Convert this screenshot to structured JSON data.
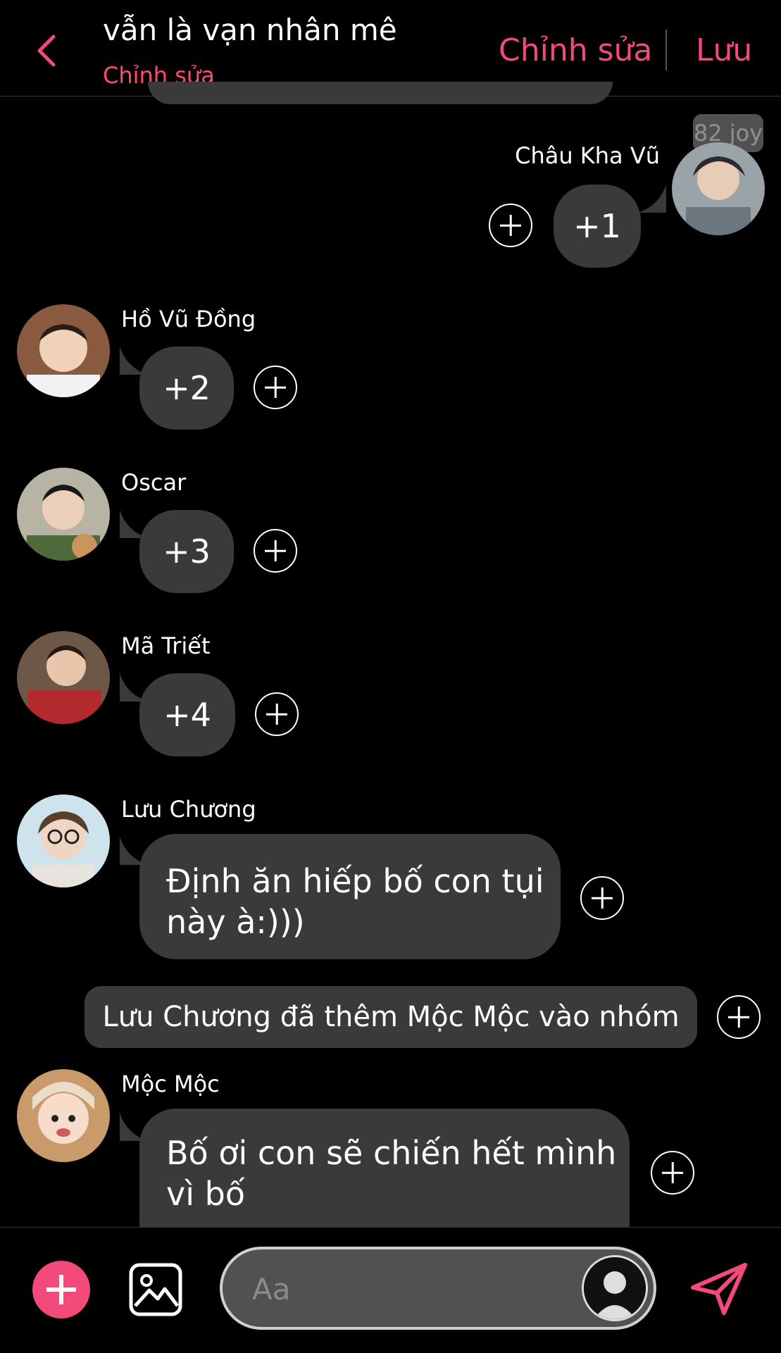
{
  "header": {
    "title": "vẫn là vạn nhân mê",
    "subtitle": "Chỉnh sửa",
    "edit_label": "Chỉnh sửa",
    "save_label": "Lưu"
  },
  "badge": "82 joy",
  "messages": [
    {
      "sender": "Châu Kha Vũ",
      "text": "+1",
      "side": "right"
    },
    {
      "sender": "Hồ Vũ Đồng",
      "text": "+2",
      "side": "left"
    },
    {
      "sender": "Oscar",
      "text": "+3",
      "side": "left"
    },
    {
      "sender": "Mã Triết",
      "text": "+4",
      "side": "left"
    },
    {
      "sender": "Lưu Chương",
      "text_lines": [
        "Định ăn hiếp bố con tụi",
        "này à:)))"
      ],
      "side": "left"
    },
    {
      "sender": "Mộc Mộc",
      "text_lines": [
        "Bố ơi con sẽ chiến hết mình",
        "vì bố"
      ],
      "side": "left"
    }
  ],
  "system_message": "Lưu Chương đã thêm Mộc Mộc vào nhóm",
  "composer": {
    "placeholder": "Aa"
  },
  "colors": {
    "accent": "#f24a7a",
    "subtitle": "#ff4c6a",
    "bubble": "#3a3a3a",
    "background": "#000000"
  },
  "icons": [
    "back-icon",
    "plus-circle-icon",
    "image-icon",
    "send-icon",
    "profile-icon"
  ]
}
